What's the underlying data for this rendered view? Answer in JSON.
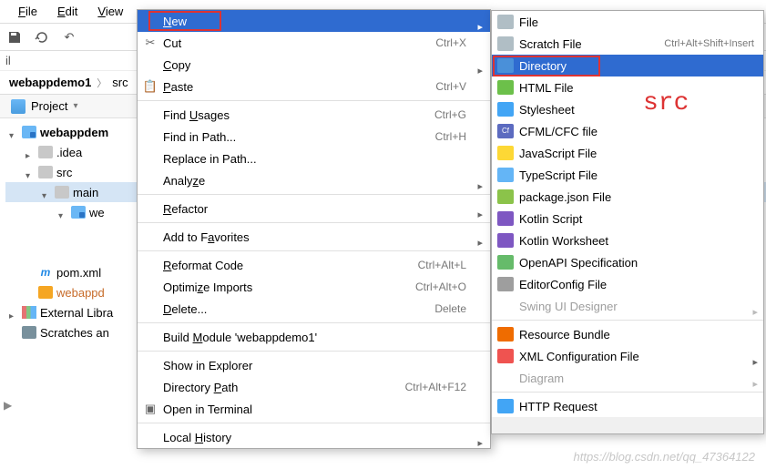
{
  "menubar": {
    "file": "File",
    "edit": "Edit",
    "view": "View"
  },
  "il": "il",
  "breadcrumb": {
    "root": "webappdemo1",
    "child": "src"
  },
  "panel": {
    "title": "Project"
  },
  "tree": {
    "root": "webappdem",
    "idea": ".idea",
    "src": "src",
    "main": "main",
    "we": "we",
    "pom": "pom.xml",
    "iml": "webappd",
    "ext": "External Libra",
    "scratch": "Scratches an"
  },
  "ctx": {
    "new": "New",
    "cut": "Cut",
    "cut_sc": "Ctrl+X",
    "copy": "Copy",
    "paste": "Paste",
    "paste_sc": "Ctrl+V",
    "findusages": "Find Usages",
    "findusages_sc": "Ctrl+G",
    "findinpath": "Find in Path...",
    "findinpath_sc": "Ctrl+H",
    "replaceinpath": "Replace in Path...",
    "analyze": "Analyze",
    "refactor": "Refactor",
    "addtofav": "Add to Favorites",
    "reformat": "Reformat Code",
    "reformat_sc": "Ctrl+Alt+L",
    "optimize": "Optimize Imports",
    "optimize_sc": "Ctrl+Alt+O",
    "delete": "Delete...",
    "delete_sc": "Delete",
    "build": "Build Module 'webappdemo1'",
    "showexp": "Show in Explorer",
    "dirpath": "Directory Path",
    "dirpath_sc": "Ctrl+Alt+F12",
    "openterm": "Open in Terminal",
    "localhist": "Local History"
  },
  "sub": {
    "file": "File",
    "scratch": "Scratch File",
    "scratch_sc": "Ctrl+Alt+Shift+Insert",
    "directory": "Directory",
    "html": "HTML File",
    "css": "Stylesheet",
    "cfml": "CFML/CFC file",
    "js": "JavaScript File",
    "ts": "TypeScript File",
    "pkg": "package.json File",
    "kts": "Kotlin Script",
    "ktw": "Kotlin Worksheet",
    "oapi": "OpenAPI Specification",
    "ec": "EditorConfig File",
    "swing": "Swing UI Designer",
    "rb": "Resource Bundle",
    "xml": "XML Configuration File",
    "diag": "Diagram",
    "http": "HTTP Request"
  },
  "annot": {
    "srclabel": "src"
  },
  "watermark": "https://blog.csdn.net/qq_47364122"
}
